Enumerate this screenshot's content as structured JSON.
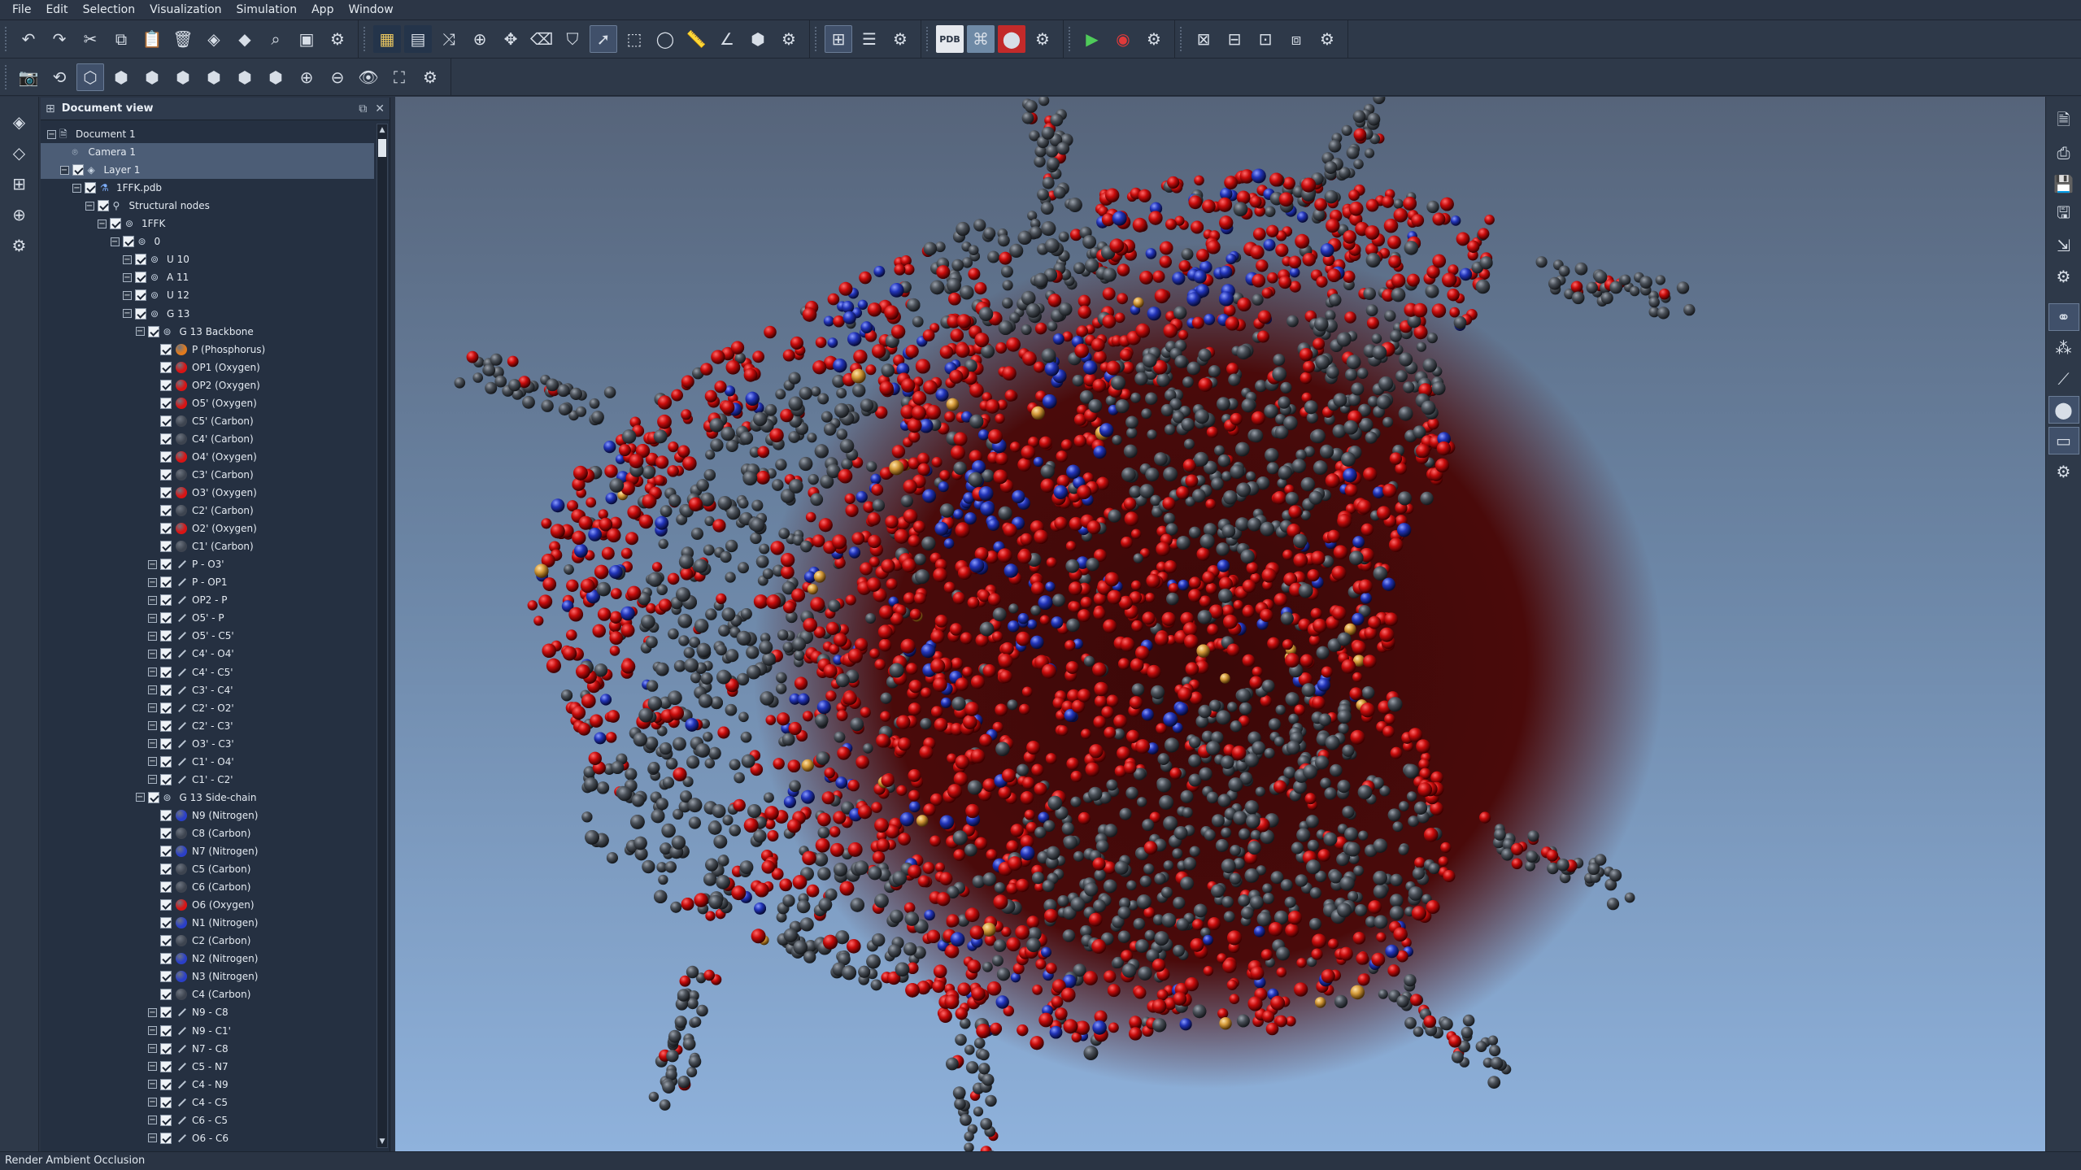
{
  "menu": [
    "File",
    "Edit",
    "Selection",
    "Visualization",
    "Simulation",
    "App",
    "Window"
  ],
  "doc_view": {
    "title": "Document view",
    "rows": [
      {
        "label": "Document 1",
        "depth": 0,
        "exp": true,
        "chk": false,
        "icon": "doc"
      },
      {
        "label": "Camera 1",
        "depth": 1,
        "exp": false,
        "chk": false,
        "icon": "camera",
        "selected": true
      },
      {
        "label": "Layer 1",
        "depth": 1,
        "exp": true,
        "chk": true,
        "icon": "layer",
        "selected": true
      },
      {
        "label": "1FFK.pdb",
        "depth": 2,
        "exp": true,
        "chk": true,
        "icon": "file"
      },
      {
        "label": "Structural nodes",
        "depth": 3,
        "exp": true,
        "chk": true,
        "icon": "struct"
      },
      {
        "label": "1FFK",
        "depth": 4,
        "exp": true,
        "chk": true,
        "icon": "chain"
      },
      {
        "label": "0",
        "depth": 5,
        "exp": true,
        "chk": true,
        "icon": "chain"
      },
      {
        "label": "U 10",
        "depth": 6,
        "exp": true,
        "chk": true,
        "icon": "residue"
      },
      {
        "label": "A 11",
        "depth": 6,
        "exp": true,
        "chk": true,
        "icon": "residue"
      },
      {
        "label": "U 12",
        "depth": 6,
        "exp": true,
        "chk": true,
        "icon": "residue"
      },
      {
        "label": "G 13",
        "depth": 6,
        "exp": true,
        "chk": true,
        "icon": "residue"
      },
      {
        "label": "G 13 Backbone",
        "depth": 7,
        "exp": true,
        "chk": true,
        "icon": "residue"
      },
      {
        "label": "P (Phosphorus)",
        "depth": 8,
        "exp": false,
        "chk": true,
        "icon": "atom",
        "color": "#e07a1e"
      },
      {
        "label": "OP1 (Oxygen)",
        "depth": 8,
        "exp": false,
        "chk": true,
        "icon": "atom",
        "color": "#d81414"
      },
      {
        "label": "OP2 (Oxygen)",
        "depth": 8,
        "exp": false,
        "chk": true,
        "icon": "atom",
        "color": "#d81414"
      },
      {
        "label": "O5' (Oxygen)",
        "depth": 8,
        "exp": false,
        "chk": true,
        "icon": "atom",
        "color": "#d81414"
      },
      {
        "label": "C5' (Carbon)",
        "depth": 8,
        "exp": false,
        "chk": true,
        "icon": "atom",
        "color": "#3d4450"
      },
      {
        "label": "C4' (Carbon)",
        "depth": 8,
        "exp": false,
        "chk": true,
        "icon": "atom",
        "color": "#3d4450"
      },
      {
        "label": "O4' (Oxygen)",
        "depth": 8,
        "exp": false,
        "chk": true,
        "icon": "atom",
        "color": "#d81414"
      },
      {
        "label": "C3' (Carbon)",
        "depth": 8,
        "exp": false,
        "chk": true,
        "icon": "atom",
        "color": "#3d4450"
      },
      {
        "label": "O3' (Oxygen)",
        "depth": 8,
        "exp": false,
        "chk": true,
        "icon": "atom",
        "color": "#d81414"
      },
      {
        "label": "C2' (Carbon)",
        "depth": 8,
        "exp": false,
        "chk": true,
        "icon": "atom",
        "color": "#3d4450"
      },
      {
        "label": "O2' (Oxygen)",
        "depth": 8,
        "exp": false,
        "chk": true,
        "icon": "atom",
        "color": "#d81414"
      },
      {
        "label": "C1' (Carbon)",
        "depth": 8,
        "exp": false,
        "chk": true,
        "icon": "atom",
        "color": "#3d4450"
      },
      {
        "label": "P - O3'",
        "depth": 8,
        "exp": true,
        "chk": true,
        "icon": "bond"
      },
      {
        "label": "P - OP1",
        "depth": 8,
        "exp": true,
        "chk": true,
        "icon": "bond"
      },
      {
        "label": "OP2 - P",
        "depth": 8,
        "exp": true,
        "chk": true,
        "icon": "bond"
      },
      {
        "label": "O5' - P",
        "depth": 8,
        "exp": true,
        "chk": true,
        "icon": "bond"
      },
      {
        "label": "O5' - C5'",
        "depth": 8,
        "exp": true,
        "chk": true,
        "icon": "bond"
      },
      {
        "label": "C4' - O4'",
        "depth": 8,
        "exp": true,
        "chk": true,
        "icon": "bond"
      },
      {
        "label": "C4' - C5'",
        "depth": 8,
        "exp": true,
        "chk": true,
        "icon": "bond"
      },
      {
        "label": "C3' - C4'",
        "depth": 8,
        "exp": true,
        "chk": true,
        "icon": "bond"
      },
      {
        "label": "C2' - O2'",
        "depth": 8,
        "exp": true,
        "chk": true,
        "icon": "bond"
      },
      {
        "label": "C2' - C3'",
        "depth": 8,
        "exp": true,
        "chk": true,
        "icon": "bond"
      },
      {
        "label": "O3' - C3'",
        "depth": 8,
        "exp": true,
        "chk": true,
        "icon": "bond"
      },
      {
        "label": "C1' - O4'",
        "depth": 8,
        "exp": true,
        "chk": true,
        "icon": "bond"
      },
      {
        "label": "C1' - C2'",
        "depth": 8,
        "exp": true,
        "chk": true,
        "icon": "bond"
      },
      {
        "label": "G 13 Side-chain",
        "depth": 7,
        "exp": true,
        "chk": true,
        "icon": "residue"
      },
      {
        "label": "N9 (Nitrogen)",
        "depth": 8,
        "exp": false,
        "chk": true,
        "icon": "atom",
        "color": "#2a3fc8"
      },
      {
        "label": "C8 (Carbon)",
        "depth": 8,
        "exp": false,
        "chk": true,
        "icon": "atom",
        "color": "#3d4450"
      },
      {
        "label": "N7 (Nitrogen)",
        "depth": 8,
        "exp": false,
        "chk": true,
        "icon": "atom",
        "color": "#2a3fc8"
      },
      {
        "label": "C5 (Carbon)",
        "depth": 8,
        "exp": false,
        "chk": true,
        "icon": "atom",
        "color": "#3d4450"
      },
      {
        "label": "C6 (Carbon)",
        "depth": 8,
        "exp": false,
        "chk": true,
        "icon": "atom",
        "color": "#3d4450"
      },
      {
        "label": "O6 (Oxygen)",
        "depth": 8,
        "exp": false,
        "chk": true,
        "icon": "atom",
        "color": "#d81414"
      },
      {
        "label": "N1 (Nitrogen)",
        "depth": 8,
        "exp": false,
        "chk": true,
        "icon": "atom",
        "color": "#2a3fc8"
      },
      {
        "label": "C2 (Carbon)",
        "depth": 8,
        "exp": false,
        "chk": true,
        "icon": "atom",
        "color": "#3d4450"
      },
      {
        "label": "N2 (Nitrogen)",
        "depth": 8,
        "exp": false,
        "chk": true,
        "icon": "atom",
        "color": "#2a3fc8"
      },
      {
        "label": "N3 (Nitrogen)",
        "depth": 8,
        "exp": false,
        "chk": true,
        "icon": "atom",
        "color": "#2a3fc8"
      },
      {
        "label": "C4 (Carbon)",
        "depth": 8,
        "exp": false,
        "chk": true,
        "icon": "atom",
        "color": "#3d4450"
      },
      {
        "label": "N9 - C8",
        "depth": 8,
        "exp": true,
        "chk": true,
        "icon": "bond"
      },
      {
        "label": "N9 - C1'",
        "depth": 8,
        "exp": true,
        "chk": true,
        "icon": "bond"
      },
      {
        "label": "N7 - C8",
        "depth": 8,
        "exp": true,
        "chk": true,
        "icon": "bond"
      },
      {
        "label": "C5 - N7",
        "depth": 8,
        "exp": true,
        "chk": true,
        "icon": "bond"
      },
      {
        "label": "C4 - N9",
        "depth": 8,
        "exp": true,
        "chk": true,
        "icon": "bond"
      },
      {
        "label": "C4 - C5",
        "depth": 8,
        "exp": true,
        "chk": true,
        "icon": "bond"
      },
      {
        "label": "C6 - C5",
        "depth": 8,
        "exp": true,
        "chk": true,
        "icon": "bond"
      },
      {
        "label": "O6 - C6",
        "depth": 8,
        "exp": true,
        "chk": true,
        "icon": "bond"
      }
    ]
  },
  "status": "Render Ambient Occlusion",
  "colors": {
    "oxygen": "#d81414",
    "carbon": "#3d4450",
    "nitrogen": "#2a3fc8",
    "phosphorus": "#e07a1e"
  }
}
